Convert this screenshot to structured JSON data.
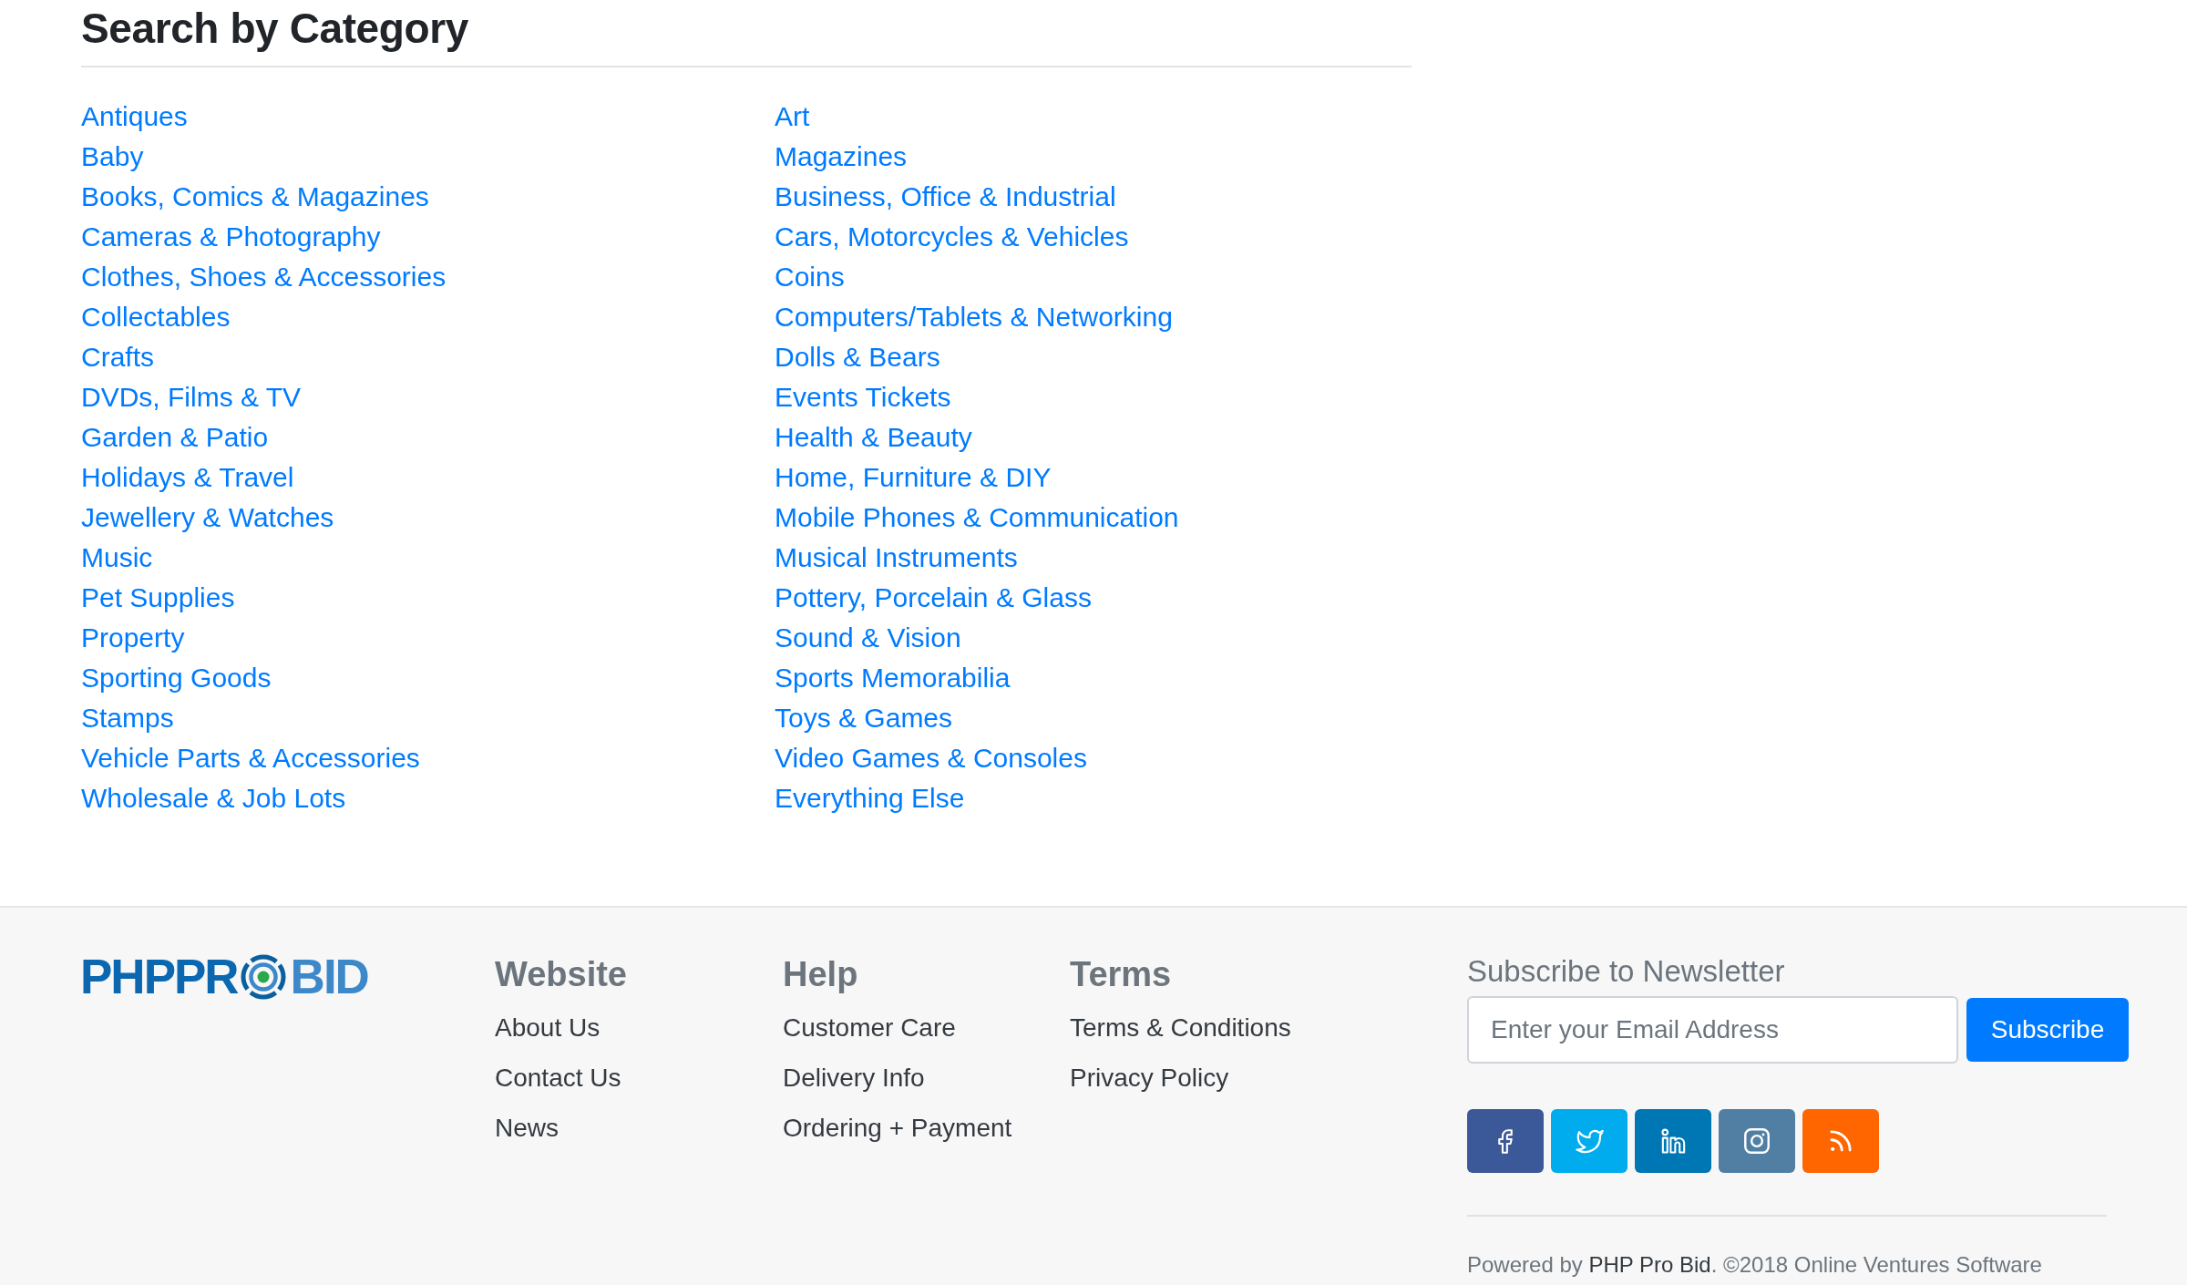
{
  "category_section": {
    "title": "Search by Category",
    "columns": [
      {
        "categories": [
          "Antiques",
          "Baby",
          "Books, Comics & Magazines",
          "Cameras & Photography",
          "Clothes, Shoes & Accessories",
          "Collectables",
          "Crafts",
          "DVDs, Films & TV",
          "Garden & Patio",
          "Holidays & Travel",
          "Jewellery & Watches",
          "Music",
          "Pet Supplies",
          "Property",
          "Sporting Goods",
          "Stamps",
          "Vehicle Parts & Accessories",
          "Wholesale & Job Lots"
        ]
      },
      {
        "categories": [
          "Art",
          "Magazines",
          "Business, Office & Industrial",
          "Cars, Motorcycles & Vehicles",
          "Coins",
          "Computers/Tablets & Networking",
          "Dolls & Bears",
          "Events Tickets",
          "Health & Beauty",
          "Home, Furniture & DIY",
          "Mobile Phones & Communication",
          "Musical Instruments",
          "Pottery, Porcelain & Glass",
          "Sound & Vision",
          "Sports Memorabilia",
          "Toys & Games",
          "Video Games & Consoles",
          "Everything Else"
        ]
      }
    ]
  },
  "footer": {
    "logo": {
      "text_before_mark": "PHPPR",
      "text_after_mark": "BID"
    },
    "link_groups": [
      {
        "heading": "Website",
        "links": [
          "About Us",
          "Contact Us",
          "News"
        ]
      },
      {
        "heading": "Help",
        "links": [
          "Customer Care",
          "Delivery Info",
          "Ordering + Payment"
        ]
      },
      {
        "heading": "Terms",
        "links": [
          "Terms & Conditions",
          "Privacy Policy"
        ]
      }
    ],
    "newsletter": {
      "title": "Subscribe to Newsletter",
      "email_field": {
        "placeholder": "Enter your Email Address"
      },
      "button": "Subscribe"
    },
    "social_links": [
      {
        "kind": "letter-f",
        "color": "#3b5998"
      },
      {
        "kind": "bird",
        "color": "#00aced"
      },
      {
        "kind": "letters-in",
        "color": "#0077b5"
      },
      {
        "kind": "camera",
        "color": "#517fa4"
      },
      {
        "kind": "feed",
        "color": "#ff6600"
      }
    ],
    "credits": {
      "prefix": "Powered by",
      "link": "PHP Pro Bid",
      "suffix": ". ©2018 Online Ventures Software"
    }
  }
}
